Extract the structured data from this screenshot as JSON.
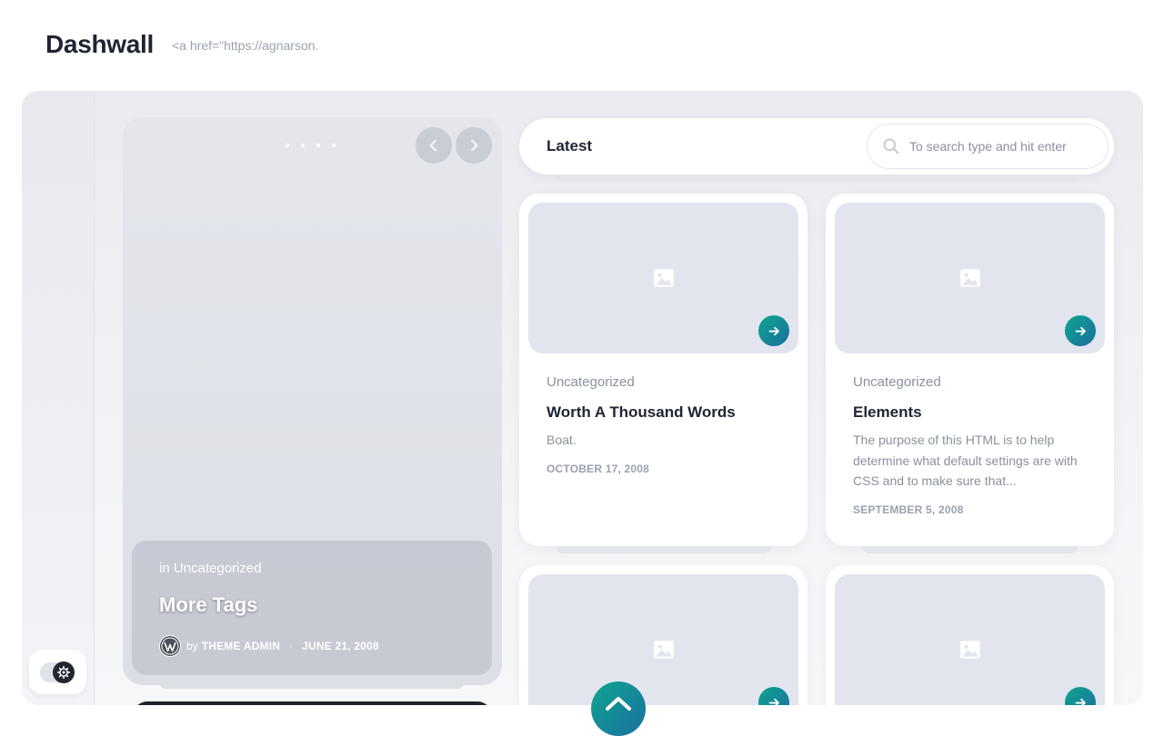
{
  "site": {
    "title": "Dashwall",
    "tagline": "<a href=\"https://agnarson."
  },
  "slider": {
    "dots": 4,
    "category_prefix": "in",
    "category": "Uncategorized",
    "title": "More Tags",
    "by_label": "by",
    "author": "THEME ADMIN",
    "separator": "·",
    "date": "JUNE 21, 2008"
  },
  "latest": {
    "title": "Latest",
    "search_placeholder": "To search type and hit enter"
  },
  "posts": [
    {
      "category": "Uncategorized",
      "title": "Worth A Thousand Words",
      "excerpt": "Boat.",
      "date": "OCTOBER 17, 2008"
    },
    {
      "category": "Uncategorized",
      "title": "Elements",
      "excerpt": "The purpose of this HTML is to help determine what default settings are with CSS and to make sure that...",
      "date": "SEPTEMBER 5, 2008"
    }
  ],
  "colors": {
    "accent_start": "#0fa58e",
    "accent_end": "#1a6fa0",
    "muted_text": "#8a909e",
    "heading_text": "#1f2433"
  },
  "icons": {
    "search": "search-icon",
    "image_placeholder": "image-icon",
    "arrow": "arrow-right-icon",
    "prev": "chevron-left-icon",
    "next": "chevron-right-icon",
    "mode": "gear-icon",
    "back_to_top": "chevron-up-icon",
    "avatar": "wordpress-icon"
  }
}
